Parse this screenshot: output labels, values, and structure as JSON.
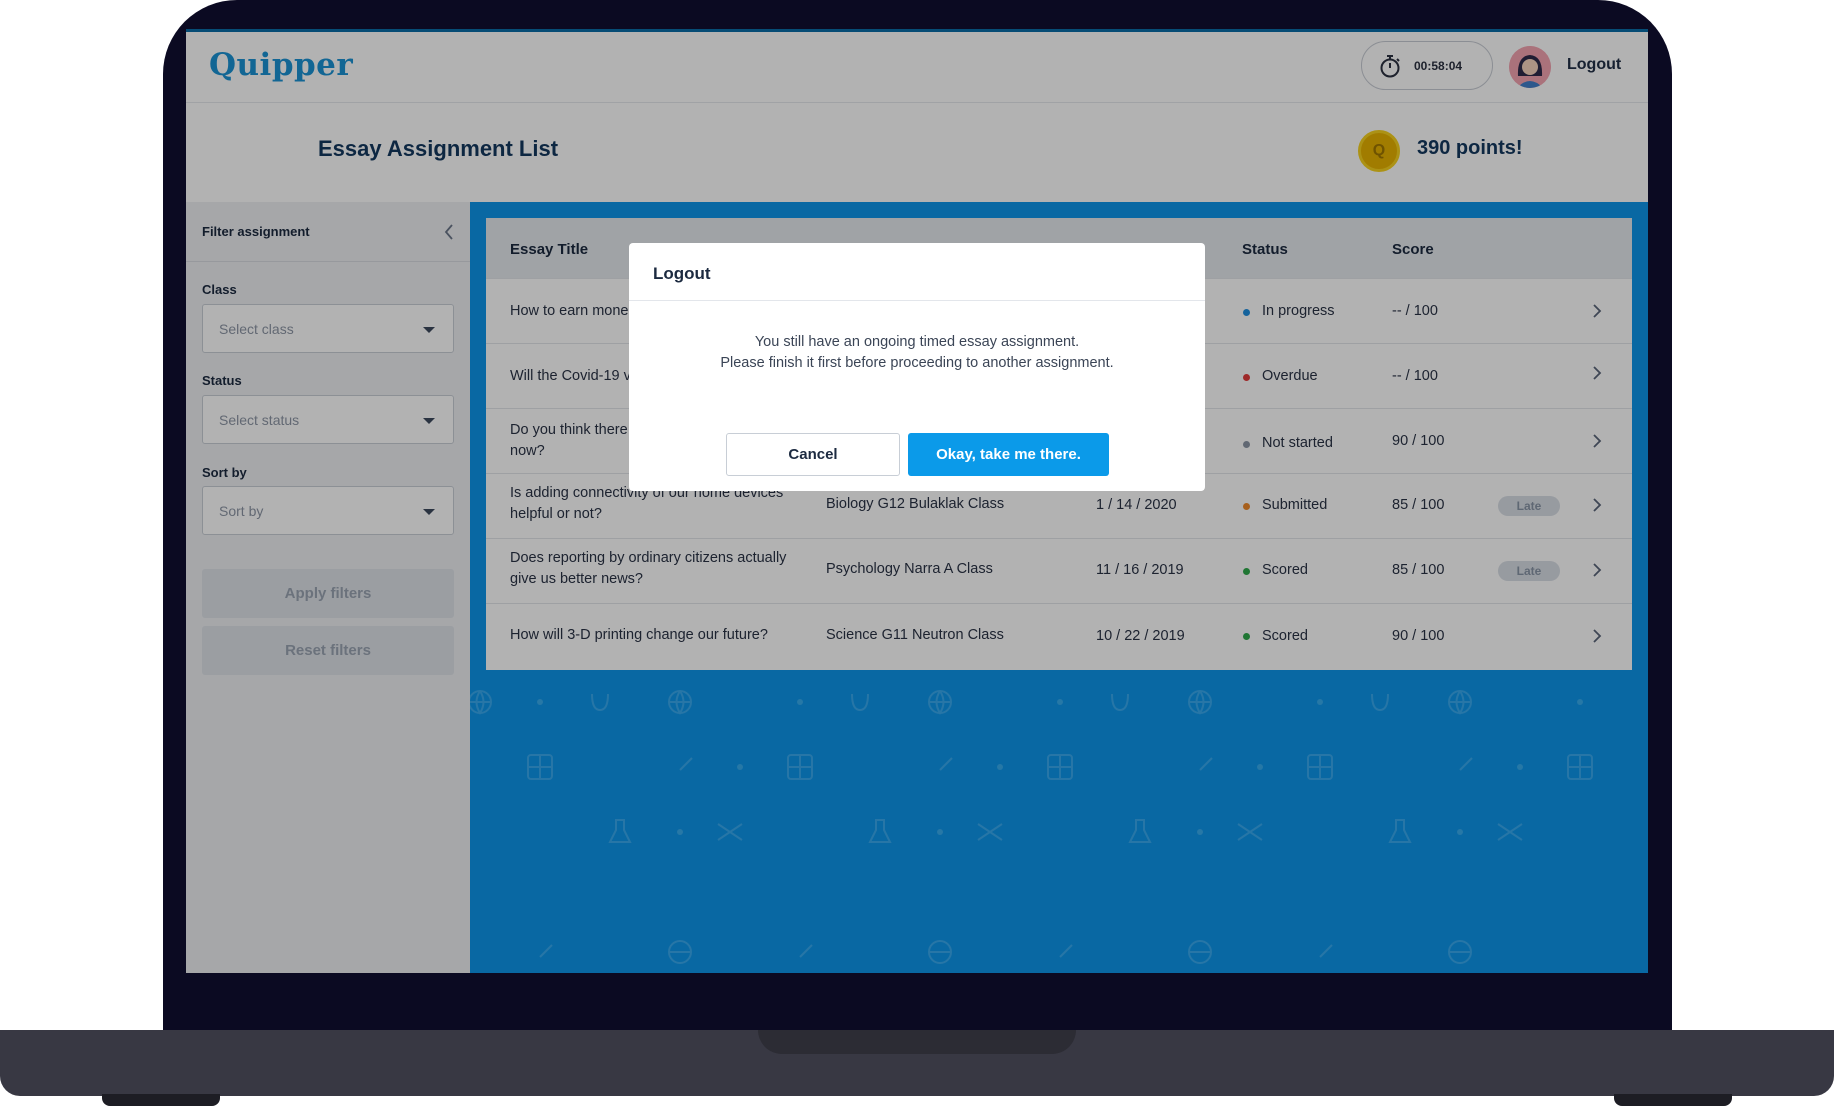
{
  "colors": {
    "accent": "#0b9ae9",
    "background_blue": "#0e96ea",
    "in_progress": "#1f8fe0",
    "overdue": "#e23b3b",
    "not_started": "#8b96a5",
    "submitted": "#f08a2b",
    "scored": "#2eaa4b"
  },
  "header": {
    "logo": "Quipper",
    "timer": "00:58:04",
    "timer_icon": "stopwatch-icon",
    "logout_label": "Logout"
  },
  "titlebar": {
    "title": "Essay Assignment List",
    "points": "390 points!",
    "coin_letter": "Q"
  },
  "sidebar": {
    "title": "Filter assignment",
    "class_label": "Class",
    "class_placeholder": "Select class",
    "status_label": "Status",
    "status_placeholder": "Select status",
    "sort_label": "Sort by",
    "sort_placeholder": "Sort by",
    "apply_label": "Apply filters",
    "reset_label": "Reset filters"
  },
  "table": {
    "headers": {
      "title": "Essay Title",
      "status": "Status",
      "score": "Score"
    },
    "rows": [
      {
        "title": "How to earn mone",
        "class": "",
        "date": "",
        "status": "In progress",
        "score": "-- / 100",
        "late": ""
      },
      {
        "title": "Will the Covid-19 v",
        "class": "",
        "date": "",
        "status": "Overdue",
        "score": "-- / 100",
        "late": ""
      },
      {
        "title": "Do you think there",
        "title2": "now?",
        "class": "",
        "date": "",
        "status": "Not started",
        "score": "90 / 100",
        "late": ""
      },
      {
        "title": "Is adding connectivity of our home devices",
        "title2": "helpful or not?",
        "class": "Biology G12 Bulaklak Class",
        "date": "1 / 14 / 2020",
        "status": "Submitted",
        "score": "85 / 100",
        "late": "Late"
      },
      {
        "title": "Does reporting by ordinary citizens actually",
        "title2": "give us better news?",
        "class": "Psychology Narra A Class",
        "date": "11 / 16 / 2019",
        "status": "Scored",
        "score": "85 / 100",
        "late": "Late"
      },
      {
        "title": "How will 3-D printing change our future?",
        "class": "Science G11 Neutron Class",
        "date": "10 / 22 / 2019",
        "status": "Scored",
        "score": "90 / 100",
        "late": ""
      }
    ]
  },
  "modal": {
    "title": "Logout",
    "message_line1": "You still have an ongoing timed essay assignment.",
    "message_line2": "Please finish it first before proceeding to another assignment.",
    "cancel_label": "Cancel",
    "confirm_label": "Okay, take me there."
  }
}
